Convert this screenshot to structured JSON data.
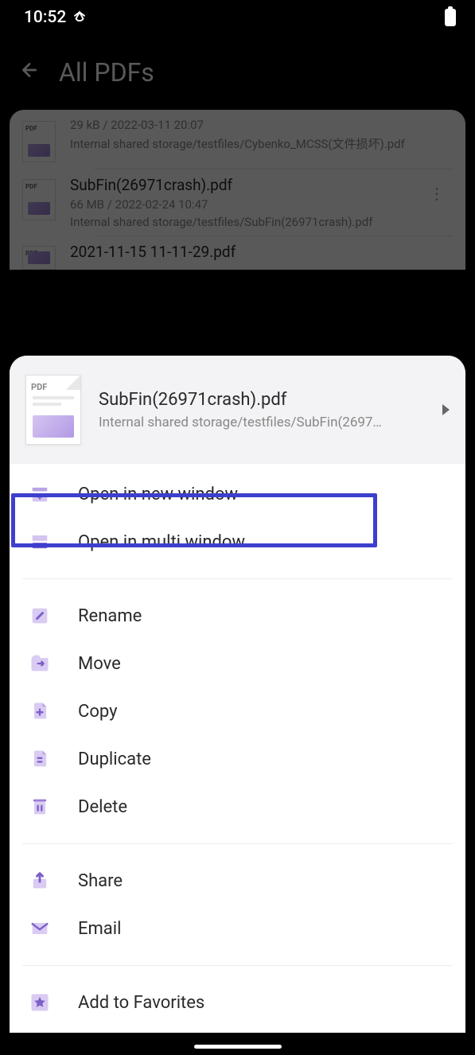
{
  "status": {
    "time": "10:52"
  },
  "header": {
    "title": "All PDFs"
  },
  "files": [
    {
      "name": "",
      "meta": "29 kB / 2022-03-11 20:07",
      "path": "Internal shared storage/testfiles/Cybenko_MCSS(文件损坏).pdf"
    },
    {
      "name": "SubFin(26971crash).pdf",
      "meta": "66 MB / 2022-02-24 10:47",
      "path": "Internal shared storage/testfiles/SubFin(26971crash).pdf"
    },
    {
      "name": "2021-11-15 11-11-29.pdf",
      "meta": "",
      "path": ""
    }
  ],
  "sheet": {
    "title": "SubFin(26971crash).pdf",
    "subtitle": "Internal shared storage/testfiles/SubFin(2697…"
  },
  "menu": {
    "open_new_window": "Open in new window",
    "open_multi_window": "Open in multi window",
    "rename": "Rename",
    "move": "Move",
    "copy": "Copy",
    "duplicate": "Duplicate",
    "delete": "Delete",
    "share": "Share",
    "email": "Email",
    "add_favorites": "Add to Favorites"
  },
  "colors": {
    "accent": "#9b7dd8",
    "accent_light": "#d4c5f0",
    "highlight": "#3d3fce"
  }
}
